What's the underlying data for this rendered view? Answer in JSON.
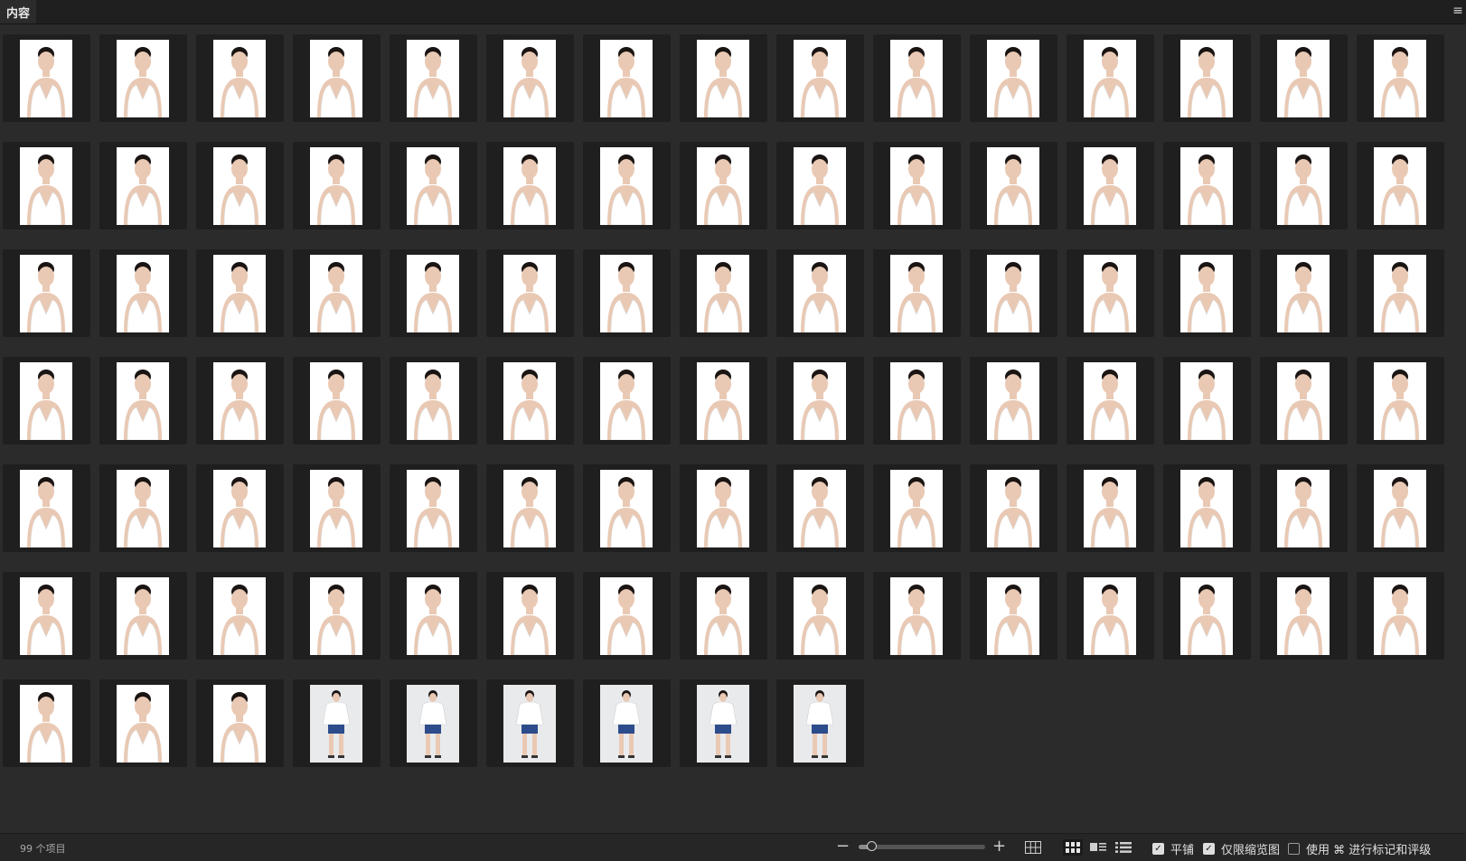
{
  "panel": {
    "tab_label": "内容",
    "menu_icon": "hamburger-menu-icon"
  },
  "content": {
    "thumbnails": [
      {
        "pose": "portrait"
      },
      {
        "pose": "portrait"
      },
      {
        "pose": "portrait"
      },
      {
        "pose": "portrait"
      },
      {
        "pose": "portrait"
      },
      {
        "pose": "portrait"
      },
      {
        "pose": "portrait"
      },
      {
        "pose": "portrait"
      },
      {
        "pose": "portrait"
      },
      {
        "pose": "portrait"
      },
      {
        "pose": "portrait"
      },
      {
        "pose": "portrait"
      },
      {
        "pose": "portrait"
      },
      {
        "pose": "portrait"
      },
      {
        "pose": "portrait"
      },
      {
        "pose": "portrait"
      },
      {
        "pose": "portrait"
      },
      {
        "pose": "portrait"
      },
      {
        "pose": "portrait"
      },
      {
        "pose": "portrait"
      },
      {
        "pose": "portrait"
      },
      {
        "pose": "portrait"
      },
      {
        "pose": "portrait"
      },
      {
        "pose": "portrait"
      },
      {
        "pose": "portrait"
      },
      {
        "pose": "portrait"
      },
      {
        "pose": "portrait"
      },
      {
        "pose": "portrait"
      },
      {
        "pose": "portrait"
      },
      {
        "pose": "portrait"
      },
      {
        "pose": "portrait"
      },
      {
        "pose": "portrait"
      },
      {
        "pose": "portrait"
      },
      {
        "pose": "portrait"
      },
      {
        "pose": "portrait"
      },
      {
        "pose": "portrait"
      },
      {
        "pose": "portrait"
      },
      {
        "pose": "portrait"
      },
      {
        "pose": "portrait"
      },
      {
        "pose": "portrait"
      },
      {
        "pose": "portrait"
      },
      {
        "pose": "portrait"
      },
      {
        "pose": "portrait"
      },
      {
        "pose": "portrait"
      },
      {
        "pose": "portrait"
      },
      {
        "pose": "portrait"
      },
      {
        "pose": "portrait"
      },
      {
        "pose": "portrait"
      },
      {
        "pose": "portrait"
      },
      {
        "pose": "portrait"
      },
      {
        "pose": "portrait"
      },
      {
        "pose": "portrait"
      },
      {
        "pose": "portrait"
      },
      {
        "pose": "portrait"
      },
      {
        "pose": "portrait"
      },
      {
        "pose": "portrait"
      },
      {
        "pose": "portrait"
      },
      {
        "pose": "portrait"
      },
      {
        "pose": "portrait"
      },
      {
        "pose": "portrait"
      },
      {
        "pose": "portrait"
      },
      {
        "pose": "portrait"
      },
      {
        "pose": "portrait"
      },
      {
        "pose": "portrait"
      },
      {
        "pose": "portrait"
      },
      {
        "pose": "portrait"
      },
      {
        "pose": "portrait"
      },
      {
        "pose": "portrait"
      },
      {
        "pose": "portrait"
      },
      {
        "pose": "portrait"
      },
      {
        "pose": "portrait"
      },
      {
        "pose": "portrait"
      },
      {
        "pose": "portrait"
      },
      {
        "pose": "portrait"
      },
      {
        "pose": "portrait"
      },
      {
        "pose": "portrait"
      },
      {
        "pose": "portrait"
      },
      {
        "pose": "portrait"
      },
      {
        "pose": "portrait"
      },
      {
        "pose": "portrait"
      },
      {
        "pose": "portrait"
      },
      {
        "pose": "portrait"
      },
      {
        "pose": "portrait"
      },
      {
        "pose": "portrait"
      },
      {
        "pose": "portrait"
      },
      {
        "pose": "portrait"
      },
      {
        "pose": "portrait"
      },
      {
        "pose": "portrait"
      },
      {
        "pose": "portrait"
      },
      {
        "pose": "portrait"
      },
      {
        "pose": "portrait"
      },
      {
        "pose": "portrait"
      },
      {
        "pose": "portrait"
      },
      {
        "pose": "fullbody"
      },
      {
        "pose": "fullbody"
      },
      {
        "pose": "fullbody"
      },
      {
        "pose": "fullbody"
      },
      {
        "pose": "fullbody"
      },
      {
        "pose": "fullbody"
      }
    ]
  },
  "statusbar": {
    "item_count": "99 个项目",
    "zoom_fraction": 0.1,
    "zoom_out_icon": "minus-icon",
    "zoom_in_icon": "plus-icon",
    "views": [
      {
        "icon": "grid-lock-icon",
        "active": false
      },
      {
        "icon": "thumbnail-view-icon",
        "active": true
      },
      {
        "icon": "detail-view-icon",
        "active": false
      },
      {
        "icon": "list-view-icon",
        "active": false
      }
    ],
    "options": [
      {
        "label": "平铺",
        "checked": true
      },
      {
        "label": "仅限缩览图",
        "checked": true
      },
      {
        "label": "使用 ⌘ 进行标记和评级",
        "checked": false
      }
    ]
  },
  "colors": {
    "background": "#2b2b2b",
    "cell": "#1f1f1f",
    "photo_background": "#ffffff",
    "dress": "#ffffff",
    "skin": "#e9c9b4",
    "hair": "#1a1413",
    "shorts": "#2c4c8c"
  }
}
